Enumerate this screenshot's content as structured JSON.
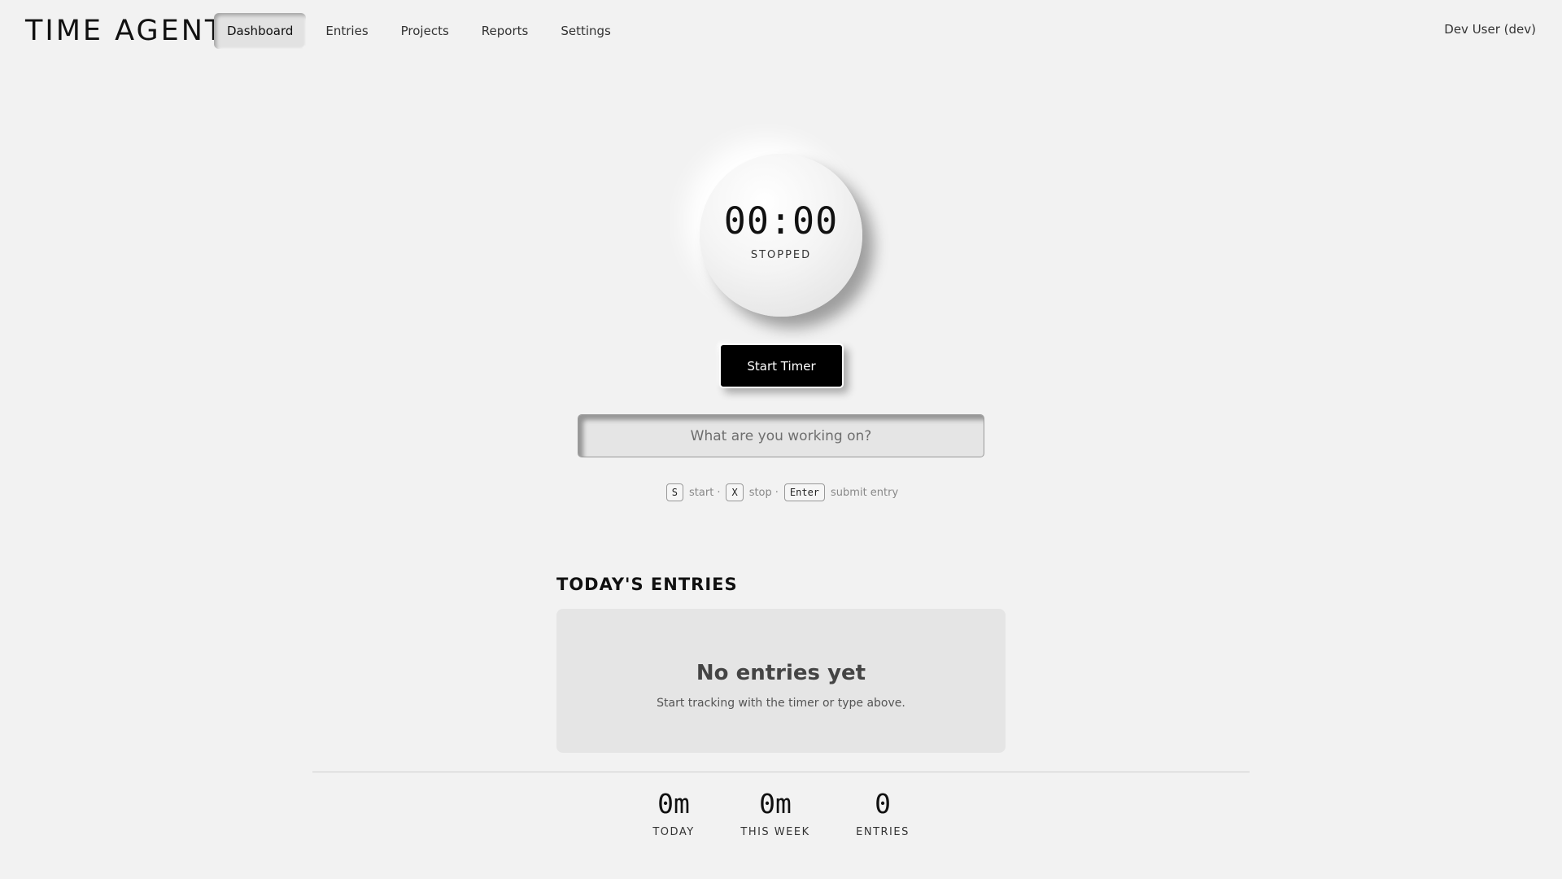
{
  "app": {
    "title": "TIME AGENT"
  },
  "nav": {
    "items": [
      {
        "label": "Dashboard",
        "active": true
      },
      {
        "label": "Entries",
        "active": false
      },
      {
        "label": "Projects",
        "active": false
      },
      {
        "label": "Reports",
        "active": false
      },
      {
        "label": "Settings",
        "active": false
      }
    ]
  },
  "user": {
    "label": "Dev User (dev)"
  },
  "timer": {
    "time": "00:00",
    "status": "STOPPED",
    "start_label": "Start Timer",
    "input_placeholder": "What are you working on?",
    "input_value": ""
  },
  "shortcuts": [
    {
      "key": "S",
      "desc": "start"
    },
    {
      "key": "X",
      "desc": "stop"
    },
    {
      "key": "Enter",
      "desc": "submit entry"
    }
  ],
  "entries": {
    "title": "TODAY'S ENTRIES",
    "empty_title": "No entries yet",
    "empty_subtitle": "Start tracking with the timer or type above."
  },
  "stats": [
    {
      "value": "0m",
      "label": "TODAY"
    },
    {
      "value": "0m",
      "label": "THIS WEEK"
    },
    {
      "value": "0",
      "label": "ENTRIES"
    }
  ],
  "colors": {
    "background": "#f2f2f2",
    "button": "#000000",
    "card": "#e5e5e5"
  }
}
